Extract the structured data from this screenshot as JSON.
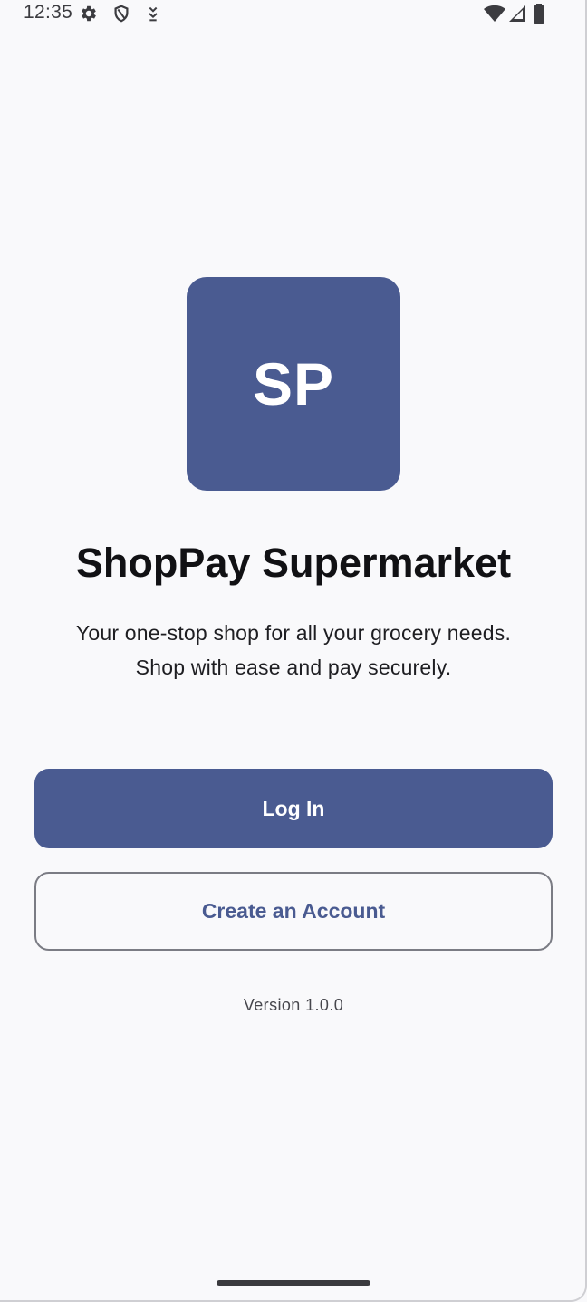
{
  "status_bar": {
    "time": "12:35",
    "left_icons": [
      "gear-icon",
      "shield-icon",
      "download-arrow-icon"
    ],
    "right_icons": [
      "wifi-icon",
      "cell-signal-icon",
      "battery-icon"
    ]
  },
  "brand": {
    "logo_text": "SP",
    "app_name": "ShopPay Supermarket",
    "tagline": "Your one-stop shop for all your grocery needs. Shop with ease and pay securely.",
    "primary_color": "#4a5b91"
  },
  "actions": {
    "login_label": "Log In",
    "create_account_label": "Create an Account"
  },
  "footer": {
    "version": "Version 1.0.0"
  }
}
